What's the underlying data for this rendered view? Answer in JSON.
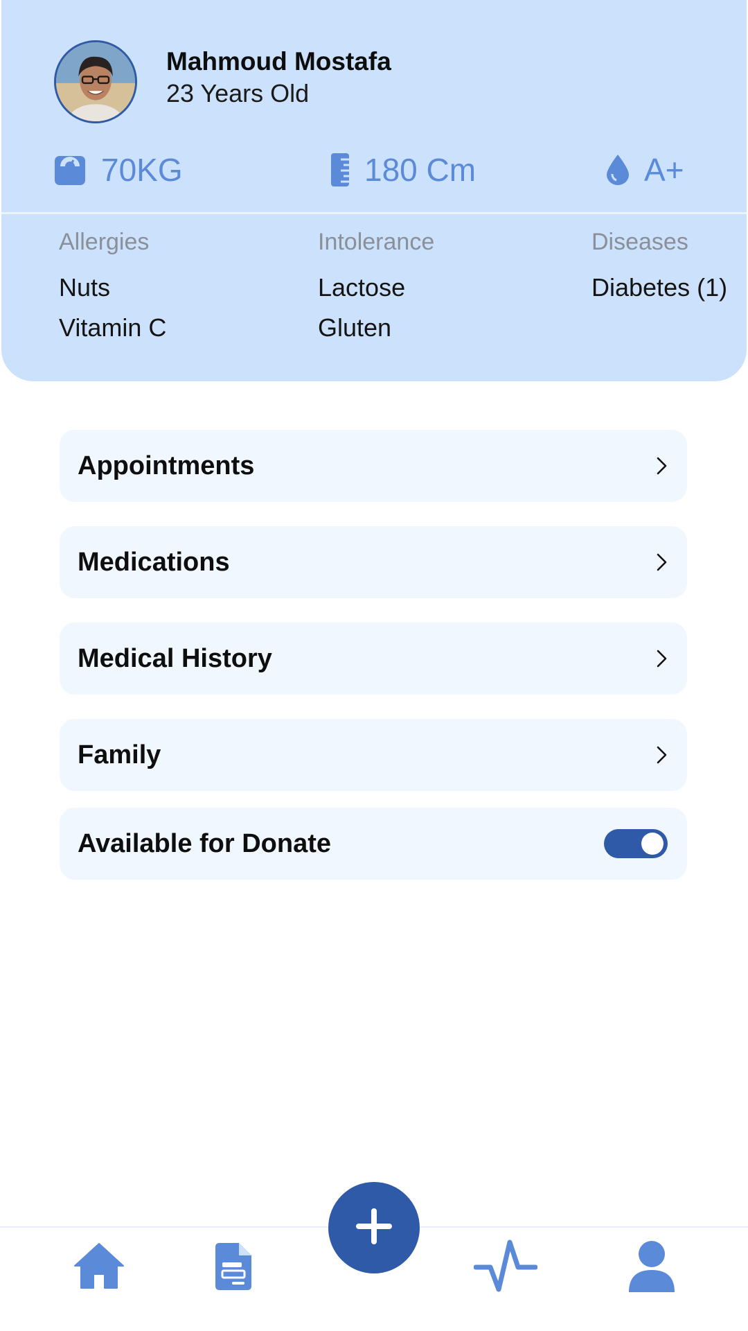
{
  "profile": {
    "name": "Mahmoud Mostafa",
    "age": "23 Years Old"
  },
  "stats": {
    "weight": {
      "icon": "scale-icon",
      "value": "70KG"
    },
    "height": {
      "icon": "ruler-icon",
      "value": "180 Cm"
    },
    "blood": {
      "icon": "blood-drop-icon",
      "value": "A+"
    }
  },
  "medical": {
    "allergies": {
      "label": "Allergies",
      "items": [
        "Nuts",
        "Vitamin C"
      ]
    },
    "intolerance": {
      "label": "Intolerance",
      "items": [
        "Lactose",
        "Gluten"
      ]
    },
    "diseases": {
      "label": "Diseases",
      "items": [
        "Diabetes (1)"
      ]
    }
  },
  "menu": [
    {
      "label": "Appointments",
      "icon": "chevron-right-icon"
    },
    {
      "label": "Medications",
      "icon": "chevron-right-icon"
    },
    {
      "label": "Medical History",
      "icon": "chevron-right-icon"
    },
    {
      "label": "Family",
      "icon": "chevron-right-icon"
    }
  ],
  "donate": {
    "label": "Available for Donate",
    "enabled": true
  },
  "nav": {
    "items": [
      "home-icon",
      "document-icon",
      "add-icon",
      "pulse-icon",
      "profile-icon"
    ],
    "active": "profile-icon"
  },
  "colors": {
    "header_bg": "#cce1fb",
    "accent": "#5b8bd8",
    "primary": "#2f5aa8",
    "card_bg": "#f1f7ff"
  }
}
